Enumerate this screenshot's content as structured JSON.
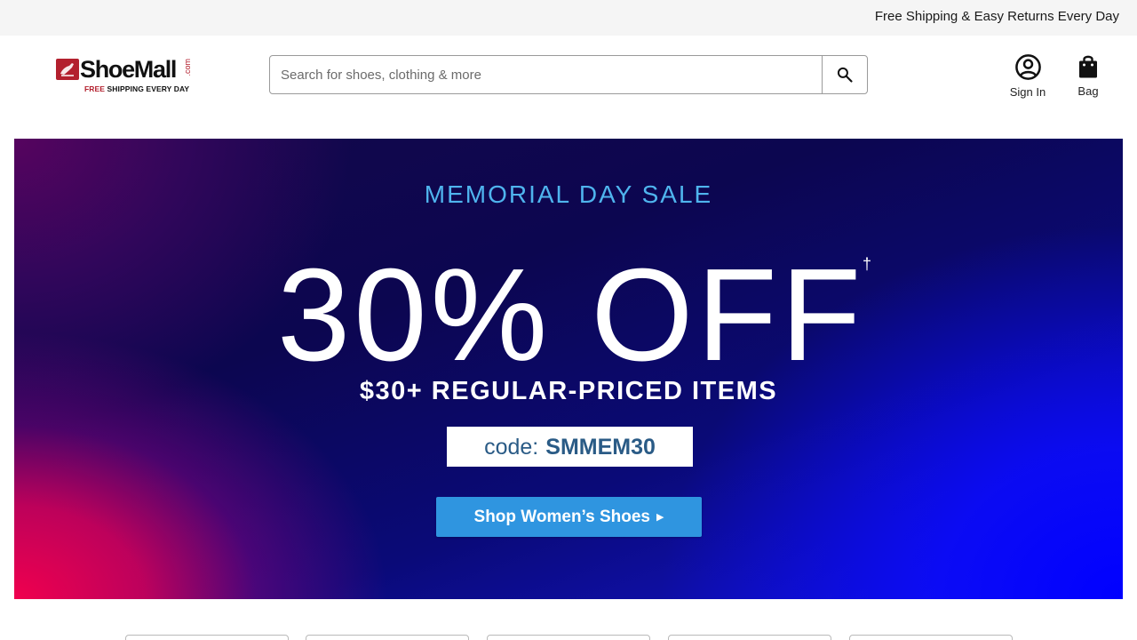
{
  "topbar": {
    "message": "Free Shipping & Easy Returns Every Day"
  },
  "logo": {
    "wordmark": "ShoeMall",
    "suffix": ".com",
    "tag_highlight": "FREE",
    "tag_rest": " SHIPPING EVERY DAY"
  },
  "search": {
    "placeholder": "Search for shoes, clothing & more",
    "value": "",
    "icon": "search-icon"
  },
  "header_actions": {
    "sign_in": {
      "label": "Sign In",
      "icon": "account-circle-icon"
    },
    "bag": {
      "label": "Bag",
      "icon": "shopping-bag-icon"
    }
  },
  "hero": {
    "kicker": "MEMORIAL DAY SALE",
    "headline": "30% OFF",
    "footnote_mark": "†",
    "subline": "$30+ REGULAR-PRICED ITEMS",
    "code_label": "code:",
    "code_value": "SMMEM30",
    "cta_label": "Shop Women’s Shoes",
    "cta_arrow": "▶"
  },
  "colors": {
    "topbar_bg": "#f5f5f5",
    "brand_red": "#b3202e",
    "hero_kicker": "#4fb4ee",
    "code_text": "#2a5b86",
    "cta_bg": "#2f95e0"
  },
  "category_tiles": [
    {
      "label": ""
    },
    {
      "label": ""
    },
    {
      "label": ""
    },
    {
      "label": ""
    },
    {
      "label": ""
    }
  ]
}
